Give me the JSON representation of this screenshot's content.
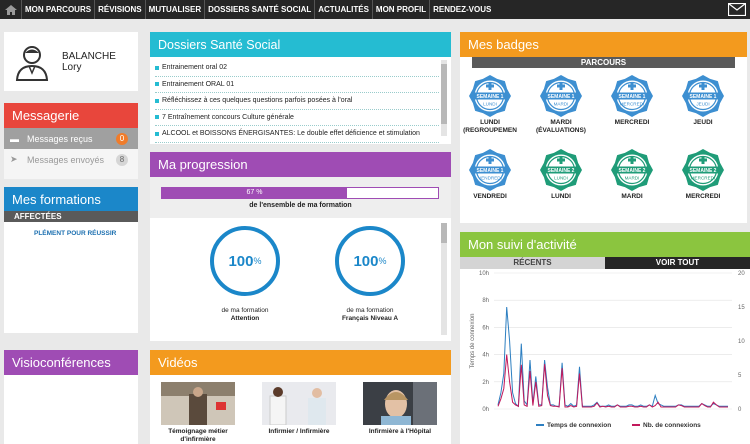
{
  "nav": {
    "items": [
      "MON PARCOURS",
      "RÉVISIONS",
      "MUTUALISER",
      "DOSSIERS SANTÉ SOCIAL",
      "ACTUALITÉS",
      "MON PROFIL",
      "RENDEZ-VOUS"
    ]
  },
  "profile": {
    "lastname": "BALANCHE",
    "firstname": "Lory"
  },
  "messagerie": {
    "title": "Messagerie",
    "recus_label": "Messages reçus",
    "recus_count": "0",
    "envoyes_label": "Messages envoyés",
    "envoyes_count": "8"
  },
  "formations": {
    "title": "Mes formations",
    "tab": "AFFECTÉES",
    "link": "PLÉMENT POUR RÉUSSIR"
  },
  "visio": {
    "title": "Visioconférences"
  },
  "dossiers": {
    "title": "Dossiers Santé Social",
    "items": [
      "Entrainement oral 02",
      "Entrainement ORAL 01",
      "Réfléchissez à ces quelques questions parfois posées à l'oral",
      "7 Entraînement concours Culture générale",
      "ALCOOL et BOISSONS ÉNERGISANTES: Le double effet déficience et stimulation"
    ]
  },
  "progression": {
    "title": "Ma progression",
    "bar_text": "67 %",
    "bar_value": 67,
    "bar_label": "de l'ensemble de ma formation",
    "circles": [
      {
        "value": "100",
        "unit": "%",
        "sub": "de ma formation",
        "name": "Attention"
      },
      {
        "value": "100",
        "unit": "%",
        "sub": "de ma formation",
        "name": "Français Niveau A"
      }
    ]
  },
  "videos": {
    "title": "Vidéos",
    "items": [
      {
        "caption1": "Témoignage métier",
        "caption2": "d'infirmière"
      },
      {
        "caption1": "Infirmier / Infirmière",
        "caption2": ""
      },
      {
        "caption1": "Infirmière à l'Hôpital",
        "caption2": ""
      }
    ]
  },
  "badges": {
    "title": "Mes badges",
    "tab": "PARCOURS",
    "items": [
      {
        "t1": "SEMAINE 1",
        "t2": "LUNDI",
        "label1": "LUNDI",
        "label2": "(REGROUPEMEN",
        "color": "#3d8fd1"
      },
      {
        "t1": "SEMAINE 1",
        "t2": "MARDI",
        "label1": "MARDI",
        "label2": "(ÉVALUATIONS)",
        "color": "#3d8fd1"
      },
      {
        "t1": "SEMAINE 1",
        "t2": "MERCREDI",
        "label1": "MERCREDI",
        "label2": "",
        "color": "#3d8fd1"
      },
      {
        "t1": "SEMAINE 1",
        "t2": "JEUDI",
        "label1": "JEUDI",
        "label2": "",
        "color": "#3d8fd1"
      },
      {
        "t1": "SEMAINE 1",
        "t2": "VENDREDI",
        "label1": "VENDREDI",
        "label2": "",
        "color": "#3d8fd1"
      },
      {
        "t1": "SEMAINE 2",
        "t2": "LUNDI",
        "label1": "LUNDI",
        "label2": "",
        "color": "#1f9c78"
      },
      {
        "t1": "SEMAINE 2",
        "t2": "MARDI",
        "label1": "MARDI",
        "label2": "",
        "color": "#1f9c78"
      },
      {
        "t1": "SEMAINE 2",
        "t2": "MERCREDI",
        "label1": "MERCREDI",
        "label2": "",
        "color": "#1f9c78"
      }
    ]
  },
  "suivi": {
    "title": "Mon suivi d'activité",
    "tab_recents": "RÉCENTS",
    "tab_voir": "VOIR TOUT"
  },
  "chart_data": {
    "type": "line",
    "ylabel": "Temps de connexion",
    "y_left_ticks": [
      "0h",
      "2h",
      "4h",
      "6h",
      "8h",
      "10h"
    ],
    "y_right_ticks": [
      "0",
      "5",
      "10",
      "15",
      "20"
    ],
    "ylim_left": [
      0,
      10
    ],
    "ylim_right": [
      0,
      20
    ],
    "series": [
      {
        "name": "Temps de connexion",
        "color": "#2d7fc1",
        "axis": "left",
        "values": [
          0.3,
          1.2,
          2.6,
          7.5,
          5.0,
          1.2,
          0.4,
          0.2,
          4.8,
          0.6,
          0.3,
          3.6,
          0.4,
          2.4,
          0.3,
          0.3,
          3.6,
          1.6,
          0.3,
          0.3,
          0.2,
          0.2,
          3.4,
          0.3,
          0.2,
          0.4,
          0.2,
          0.3,
          3.1,
          0.2,
          0.2,
          0.2,
          0.2,
          0.3,
          0.5,
          0.2,
          0.2,
          0.2,
          0.3,
          0.2,
          0.2,
          0.3,
          0.2,
          0.2,
          0.2,
          0.3,
          0.3,
          0.2,
          0.2,
          0.3,
          0.2,
          0.2,
          0.3,
          0.2,
          1.0,
          0.4,
          0.3,
          0.2,
          0.2,
          0.2,
          0.2,
          0.2,
          0.3,
          0.3,
          0.2,
          0.2,
          0.2,
          0.2,
          0.2,
          0.2,
          0.4,
          0.3,
          0.2,
          0.2,
          0.4,
          0.3,
          0.2,
          0.2,
          0.2,
          0.2
        ]
      },
      {
        "name": "Nb. de connexions",
        "color": "#c2185b",
        "axis": "right",
        "values": [
          0.4,
          1.5,
          3.0,
          8.0,
          4.0,
          1.0,
          0.6,
          0.4,
          6.5,
          0.6,
          0.4,
          5.6,
          0.5,
          4.0,
          0.4,
          0.5,
          6.6,
          2.0,
          0.5,
          0.4,
          0.4,
          0.3,
          6.0,
          0.3,
          0.3,
          0.5,
          0.3,
          0.4,
          5.2,
          0.3,
          0.3,
          0.3,
          0.3,
          0.4,
          0.9,
          0.3,
          0.4,
          0.3,
          0.4,
          0.3,
          0.3,
          0.6,
          0.3,
          0.3,
          0.3,
          0.4,
          0.4,
          0.3,
          0.3,
          0.4,
          0.3,
          0.3,
          0.6,
          0.3,
          0.5,
          1.0,
          0.3,
          0.3,
          0.3,
          0.3,
          0.3,
          0.3,
          0.6,
          0.5,
          0.3,
          0.3,
          0.3,
          0.3,
          0.3,
          0.3,
          0.8,
          0.5,
          0.3,
          0.3,
          1.0,
          0.6,
          0.3,
          0.3,
          0.3,
          0.3
        ]
      }
    ]
  }
}
